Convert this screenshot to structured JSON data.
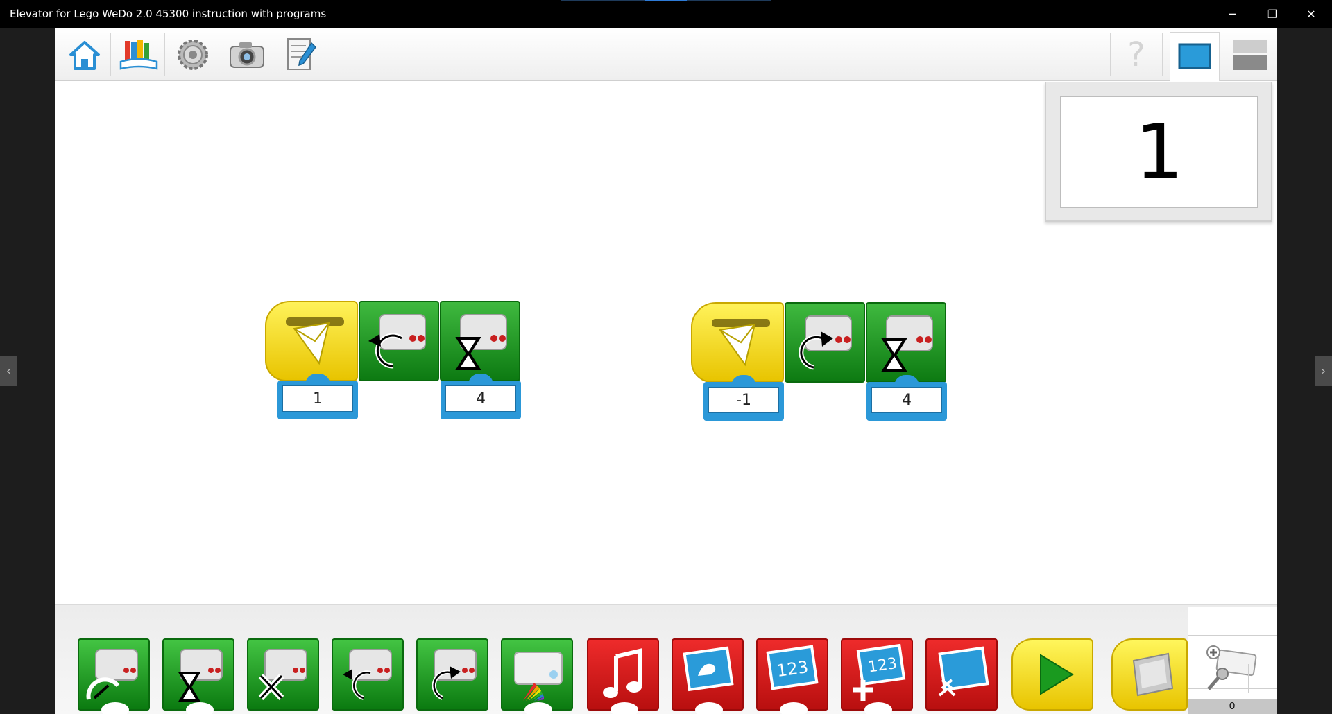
{
  "window": {
    "title": "Elevator for Lego WeDo 2.0 45300 instruction with programs",
    "minimize_glyph": "─",
    "restore_glyph": "❐",
    "close_glyph": "✕"
  },
  "nav": {
    "prev_glyph": "‹",
    "next_glyph": "›"
  },
  "toolbar": {
    "left": [
      "home-icon",
      "library-icon",
      "gear-icon",
      "camera-icon",
      "document-icon"
    ],
    "right": [
      "help-icon",
      "display-icon",
      "grey-panel-icon"
    ]
  },
  "display": {
    "value": "1"
  },
  "programs": [
    {
      "message": "1",
      "motor_direction": "counterclockwise",
      "wait_value": "4"
    },
    {
      "message": "-1",
      "motor_direction": "clockwise",
      "wait_value": "4"
    }
  ],
  "palette": {
    "blocks": [
      {
        "name": "motor-power-block",
        "color": "green"
      },
      {
        "name": "motor-on-for-block",
        "color": "green"
      },
      {
        "name": "motor-off-block",
        "color": "green"
      },
      {
        "name": "motor-counterclockwise-block",
        "color": "green"
      },
      {
        "name": "motor-clockwise-block",
        "color": "green"
      },
      {
        "name": "light-color-block",
        "color": "green"
      },
      {
        "name": "play-sound-block",
        "color": "red"
      },
      {
        "name": "display-background-block",
        "color": "red"
      },
      {
        "name": "display-number-block",
        "color": "red"
      },
      {
        "name": "add-to-display-block",
        "color": "red"
      },
      {
        "name": "display-size-block",
        "color": "red"
      },
      {
        "name": "start-block",
        "color": "yellow"
      },
      {
        "name": "start-on-key-block",
        "color": "yellow"
      }
    ]
  },
  "hub": {
    "count": "0"
  },
  "colors": {
    "green": "#1a9a1f",
    "red": "#d31818",
    "yellow": "#f5d800",
    "blue": "#2b98d8"
  }
}
